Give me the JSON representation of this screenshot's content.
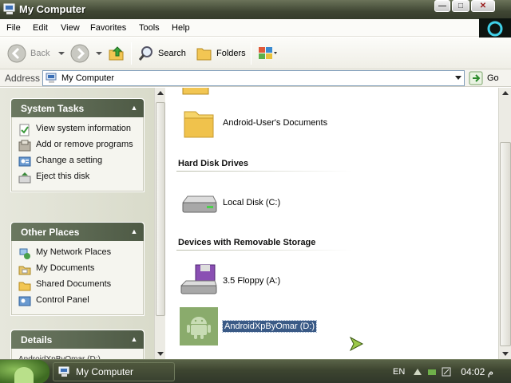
{
  "window": {
    "title": "My Computer",
    "controls": {
      "minimize": "—",
      "maximize": "□",
      "close": "✕"
    }
  },
  "menu": [
    "File",
    "Edit",
    "View",
    "Favorites",
    "Tools",
    "Help"
  ],
  "toolbar": {
    "back_label": "Back",
    "search_label": "Search",
    "folders_label": "Folders"
  },
  "address": {
    "label": "Address",
    "value": "My Computer",
    "go_label": "Go"
  },
  "left_pane": {
    "system_tasks": {
      "title": "System Tasks",
      "items": [
        "View system information",
        "Add or remove programs",
        "Change a setting",
        "Eject this disk"
      ]
    },
    "other_places": {
      "title": "Other Places",
      "items": [
        "My Network Places",
        "My Documents",
        "Shared Documents",
        "Control Panel"
      ]
    },
    "details": {
      "title": "Details",
      "item": "AndroidXpByOmar (D:)"
    }
  },
  "main": {
    "top_item": "Android-User's Documents",
    "sections": [
      {
        "title": "Hard Disk Drives",
        "items": [
          "Local Disk (C:)"
        ]
      },
      {
        "title": "Devices with Removable Storage",
        "items": [
          "3.5 Floppy (A:)",
          "AndroidXpByOmar (D:)"
        ]
      }
    ]
  },
  "taskbar": {
    "task_label": "My Computer",
    "language": "EN",
    "clock": "04:02 م"
  },
  "colors": {
    "title_bar": "#3f4633",
    "panel_header": "#5c6a52",
    "selection": "#3a5a86",
    "taskbar": "#3d4530",
    "android_tile": "#8aab6c"
  }
}
